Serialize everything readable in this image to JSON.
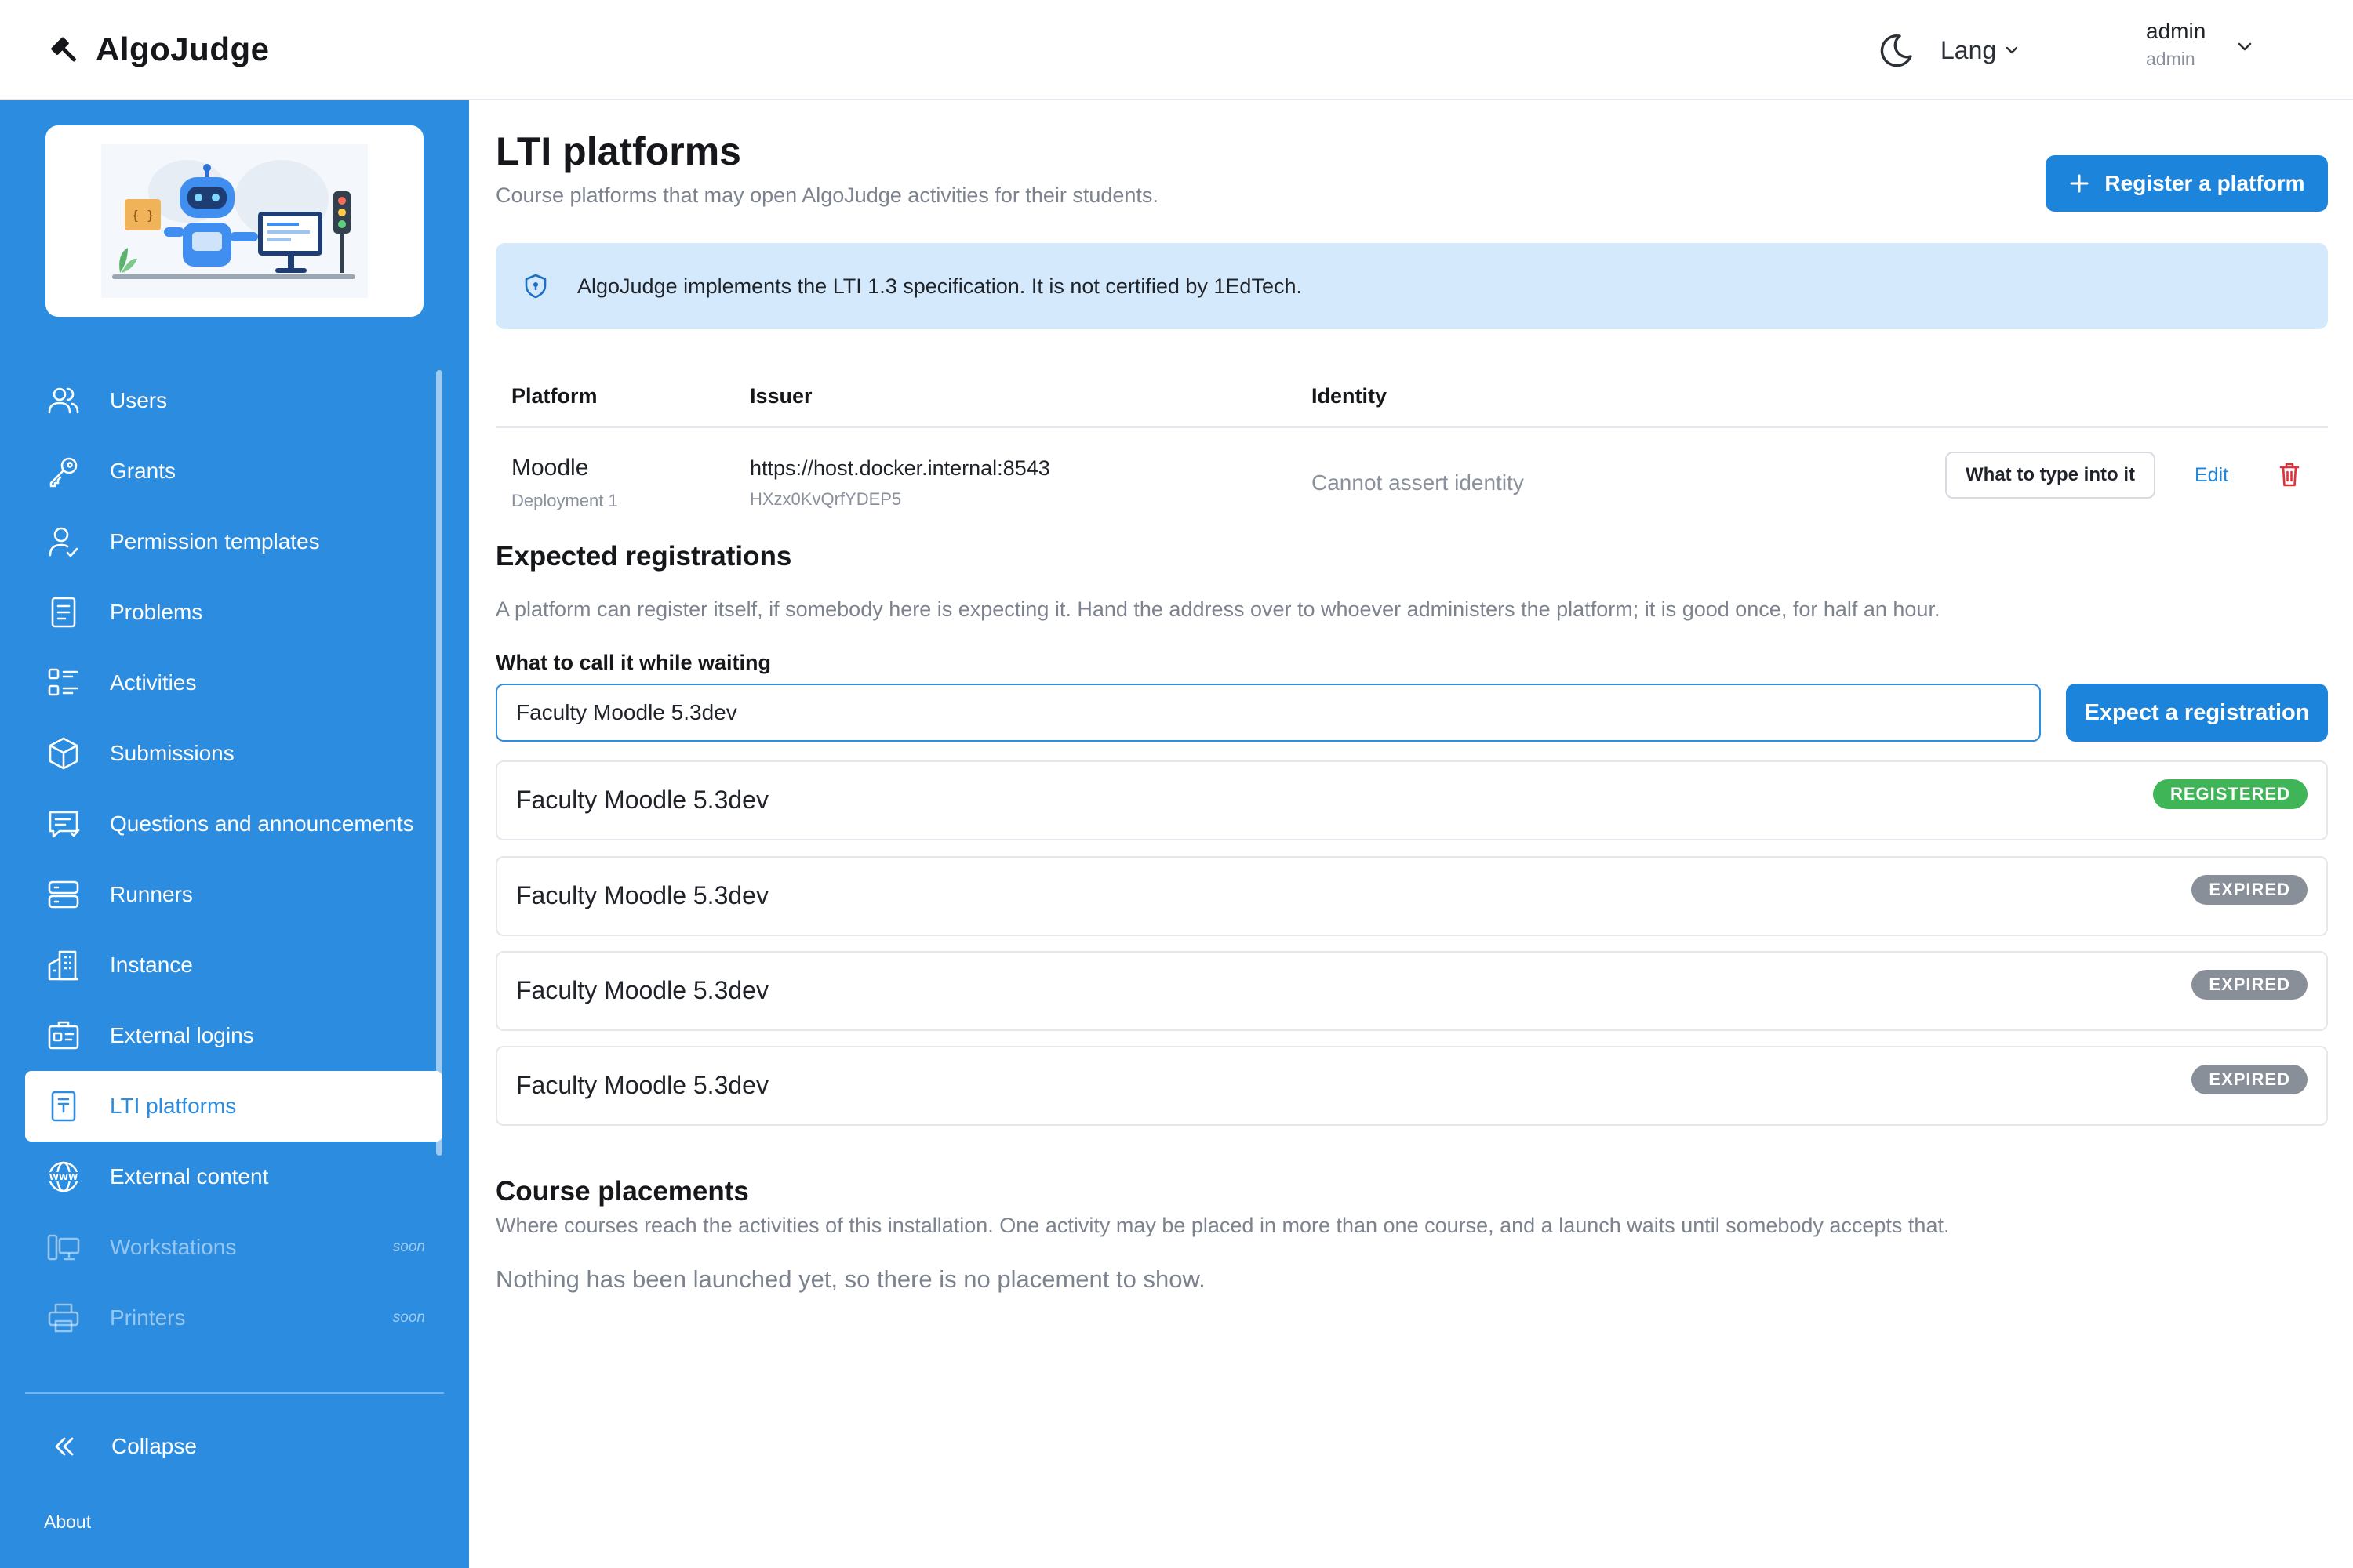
{
  "header": {
    "brand": "AlgoJudge",
    "lang_label": "Lang",
    "user": {
      "name": "admin",
      "role": "admin"
    }
  },
  "sidebar": {
    "items": [
      {
        "label": "Users",
        "icon": "users-icon"
      },
      {
        "label": "Grants",
        "icon": "key-icon"
      },
      {
        "label": "Permission templates",
        "icon": "user-check-icon"
      },
      {
        "label": "Problems",
        "icon": "document-icon"
      },
      {
        "label": "Activities",
        "icon": "list-icon"
      },
      {
        "label": "Submissions",
        "icon": "cube-icon"
      },
      {
        "label": "Questions and announcements",
        "icon": "chat-icon"
      },
      {
        "label": "Runners",
        "icon": "server-icon"
      },
      {
        "label": "Instance",
        "icon": "building-icon"
      },
      {
        "label": "External logins",
        "icon": "id-card-icon"
      },
      {
        "label": "LTI platforms",
        "icon": "lti-document-icon",
        "active": true
      },
      {
        "label": "External content",
        "icon": "globe-www-icon"
      },
      {
        "label": "Workstations",
        "icon": "workstation-icon",
        "soon": "soon"
      },
      {
        "label": "Printers",
        "icon": "printer-icon",
        "soon": "soon"
      }
    ],
    "collapse_label": "Collapse",
    "about_label": "About"
  },
  "main": {
    "title": "LTI platforms",
    "subtitle": "Course platforms that may open AlgoJudge activities for their students.",
    "register_button": "Register a platform",
    "info_banner": "AlgoJudge implements the LTI 1.3 specification. It is not certified by 1EdTech.",
    "table": {
      "headers": {
        "platform": "Platform",
        "issuer": "Issuer",
        "identity": "Identity"
      },
      "rows": [
        {
          "platform": "Moodle",
          "deployment": "Deployment 1",
          "issuer": "https://host.docker.internal:8543",
          "client_id": "HXzx0KvQrfYDEP5",
          "identity": "Cannot assert identity",
          "type_button": "What to type into it",
          "edit_label": "Edit"
        }
      ]
    },
    "expected": {
      "title": "Expected registrations",
      "description": "A platform can register itself, if somebody here is expecting it. Hand the address over to whoever administers the platform; it is good once, for half an hour.",
      "field_label": "What to call it while waiting",
      "field_value": "Faculty Moodle 5.3dev",
      "button": "Expect a registration",
      "items": [
        {
          "name": "Faculty Moodle 5.3dev",
          "status": "REGISTERED"
        },
        {
          "name": "Faculty Moodle 5.3dev",
          "status": "EXPIRED"
        },
        {
          "name": "Faculty Moodle 5.3dev",
          "status": "EXPIRED"
        },
        {
          "name": "Faculty Moodle 5.3dev",
          "status": "EXPIRED"
        }
      ]
    },
    "placements": {
      "title": "Course placements",
      "description": "Where courses reach the activities of this installation. One activity may be placed in more than one course, and a launch waits until somebody accepts that.",
      "empty": "Nothing has been launched yet, so there is no placement to show."
    }
  },
  "colors": {
    "sidebar_bg": "#2b8ce0",
    "primary": "#1d84dc",
    "info_bg": "#d4e9fb",
    "registered": "#3fb557",
    "expired": "#888f99",
    "danger": "#e0323a"
  }
}
